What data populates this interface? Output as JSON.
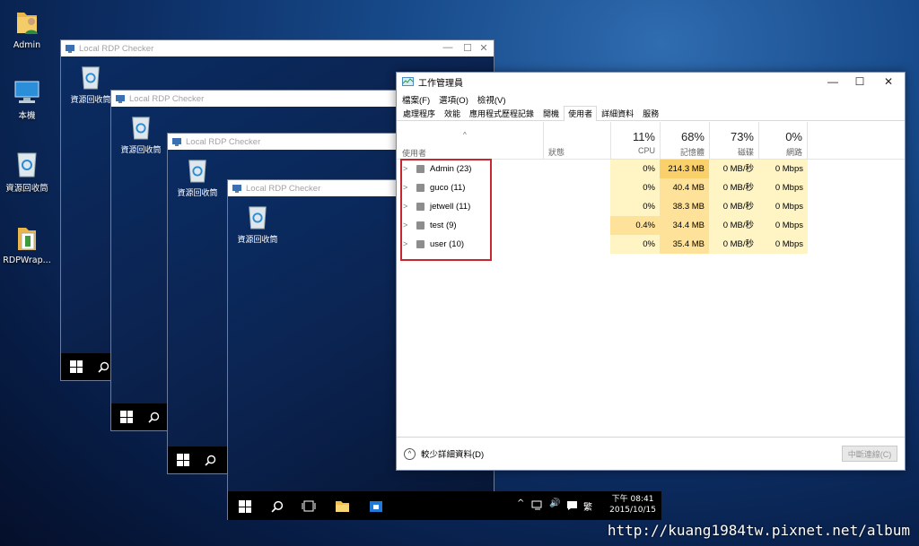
{
  "desktop": {
    "icons": [
      {
        "label": "Admin"
      },
      {
        "label": "本機"
      },
      {
        "label": "資源回收筒"
      },
      {
        "label": "RDPWrap..."
      }
    ]
  },
  "rdp_windows": [
    {
      "title": "Local RDP Checker",
      "bin_label": "資源回收筒"
    },
    {
      "title": "Local RDP Checker",
      "bin_label": "資源回收筒"
    },
    {
      "title": "Local RDP Checker",
      "bin_label": "資源回收筒"
    },
    {
      "title": "Local RDP Checker",
      "bin_label": "資源回收筒"
    }
  ],
  "task_manager": {
    "title": "工作管理員",
    "controls": {
      "minimize": "—",
      "maximize": "☐",
      "close": "✕"
    },
    "menu": [
      "檔案(F)",
      "選項(O)",
      "檢視(V)"
    ],
    "tabs": [
      "處理程序",
      "效能",
      "應用程式歷程記錄",
      "開機",
      "使用者",
      "詳細資料",
      "服務"
    ],
    "active_tab": "使用者",
    "columns": {
      "user": "使用者",
      "status": "狀態",
      "cpu": {
        "pct": "11%",
        "label": "CPU"
      },
      "memory": {
        "pct": "68%",
        "label": "記憶體"
      },
      "disk": {
        "pct": "73%",
        "label": "磁碟"
      },
      "network": {
        "pct": "0%",
        "label": "網路"
      }
    },
    "rows": [
      {
        "name": "Admin (23)",
        "cpu": "0%",
        "memory": "214.3 MB",
        "disk": "0 MB/秒",
        "network": "0 Mbps"
      },
      {
        "name": "guco (11)",
        "cpu": "0%",
        "memory": "40.4 MB",
        "disk": "0 MB/秒",
        "network": "0 Mbps"
      },
      {
        "name": "jetwell (11)",
        "cpu": "0%",
        "memory": "38.3 MB",
        "disk": "0 MB/秒",
        "network": "0 Mbps"
      },
      {
        "name": "test (9)",
        "cpu": "0.4%",
        "memory": "34.4 MB",
        "disk": "0 MB/秒",
        "network": "0 Mbps"
      },
      {
        "name": "user (10)",
        "cpu": "0%",
        "memory": "35.4 MB",
        "disk": "0 MB/秒",
        "network": "0 Mbps"
      }
    ],
    "footer": {
      "less_details": "較少詳細資料(D)",
      "disconnect": "中斷連線(C)"
    }
  },
  "taskbar": {
    "ime": "繁",
    "time": "下午 08:41",
    "date": "2015/10/15"
  },
  "watermark": "http://kuang1984tw.pixnet.net/album",
  "colors": {
    "highlight_red": "#c72830",
    "heat_light": "#fff4c4",
    "heat_mid": "#ffe29a",
    "heat_strong": "#f9d06a"
  }
}
